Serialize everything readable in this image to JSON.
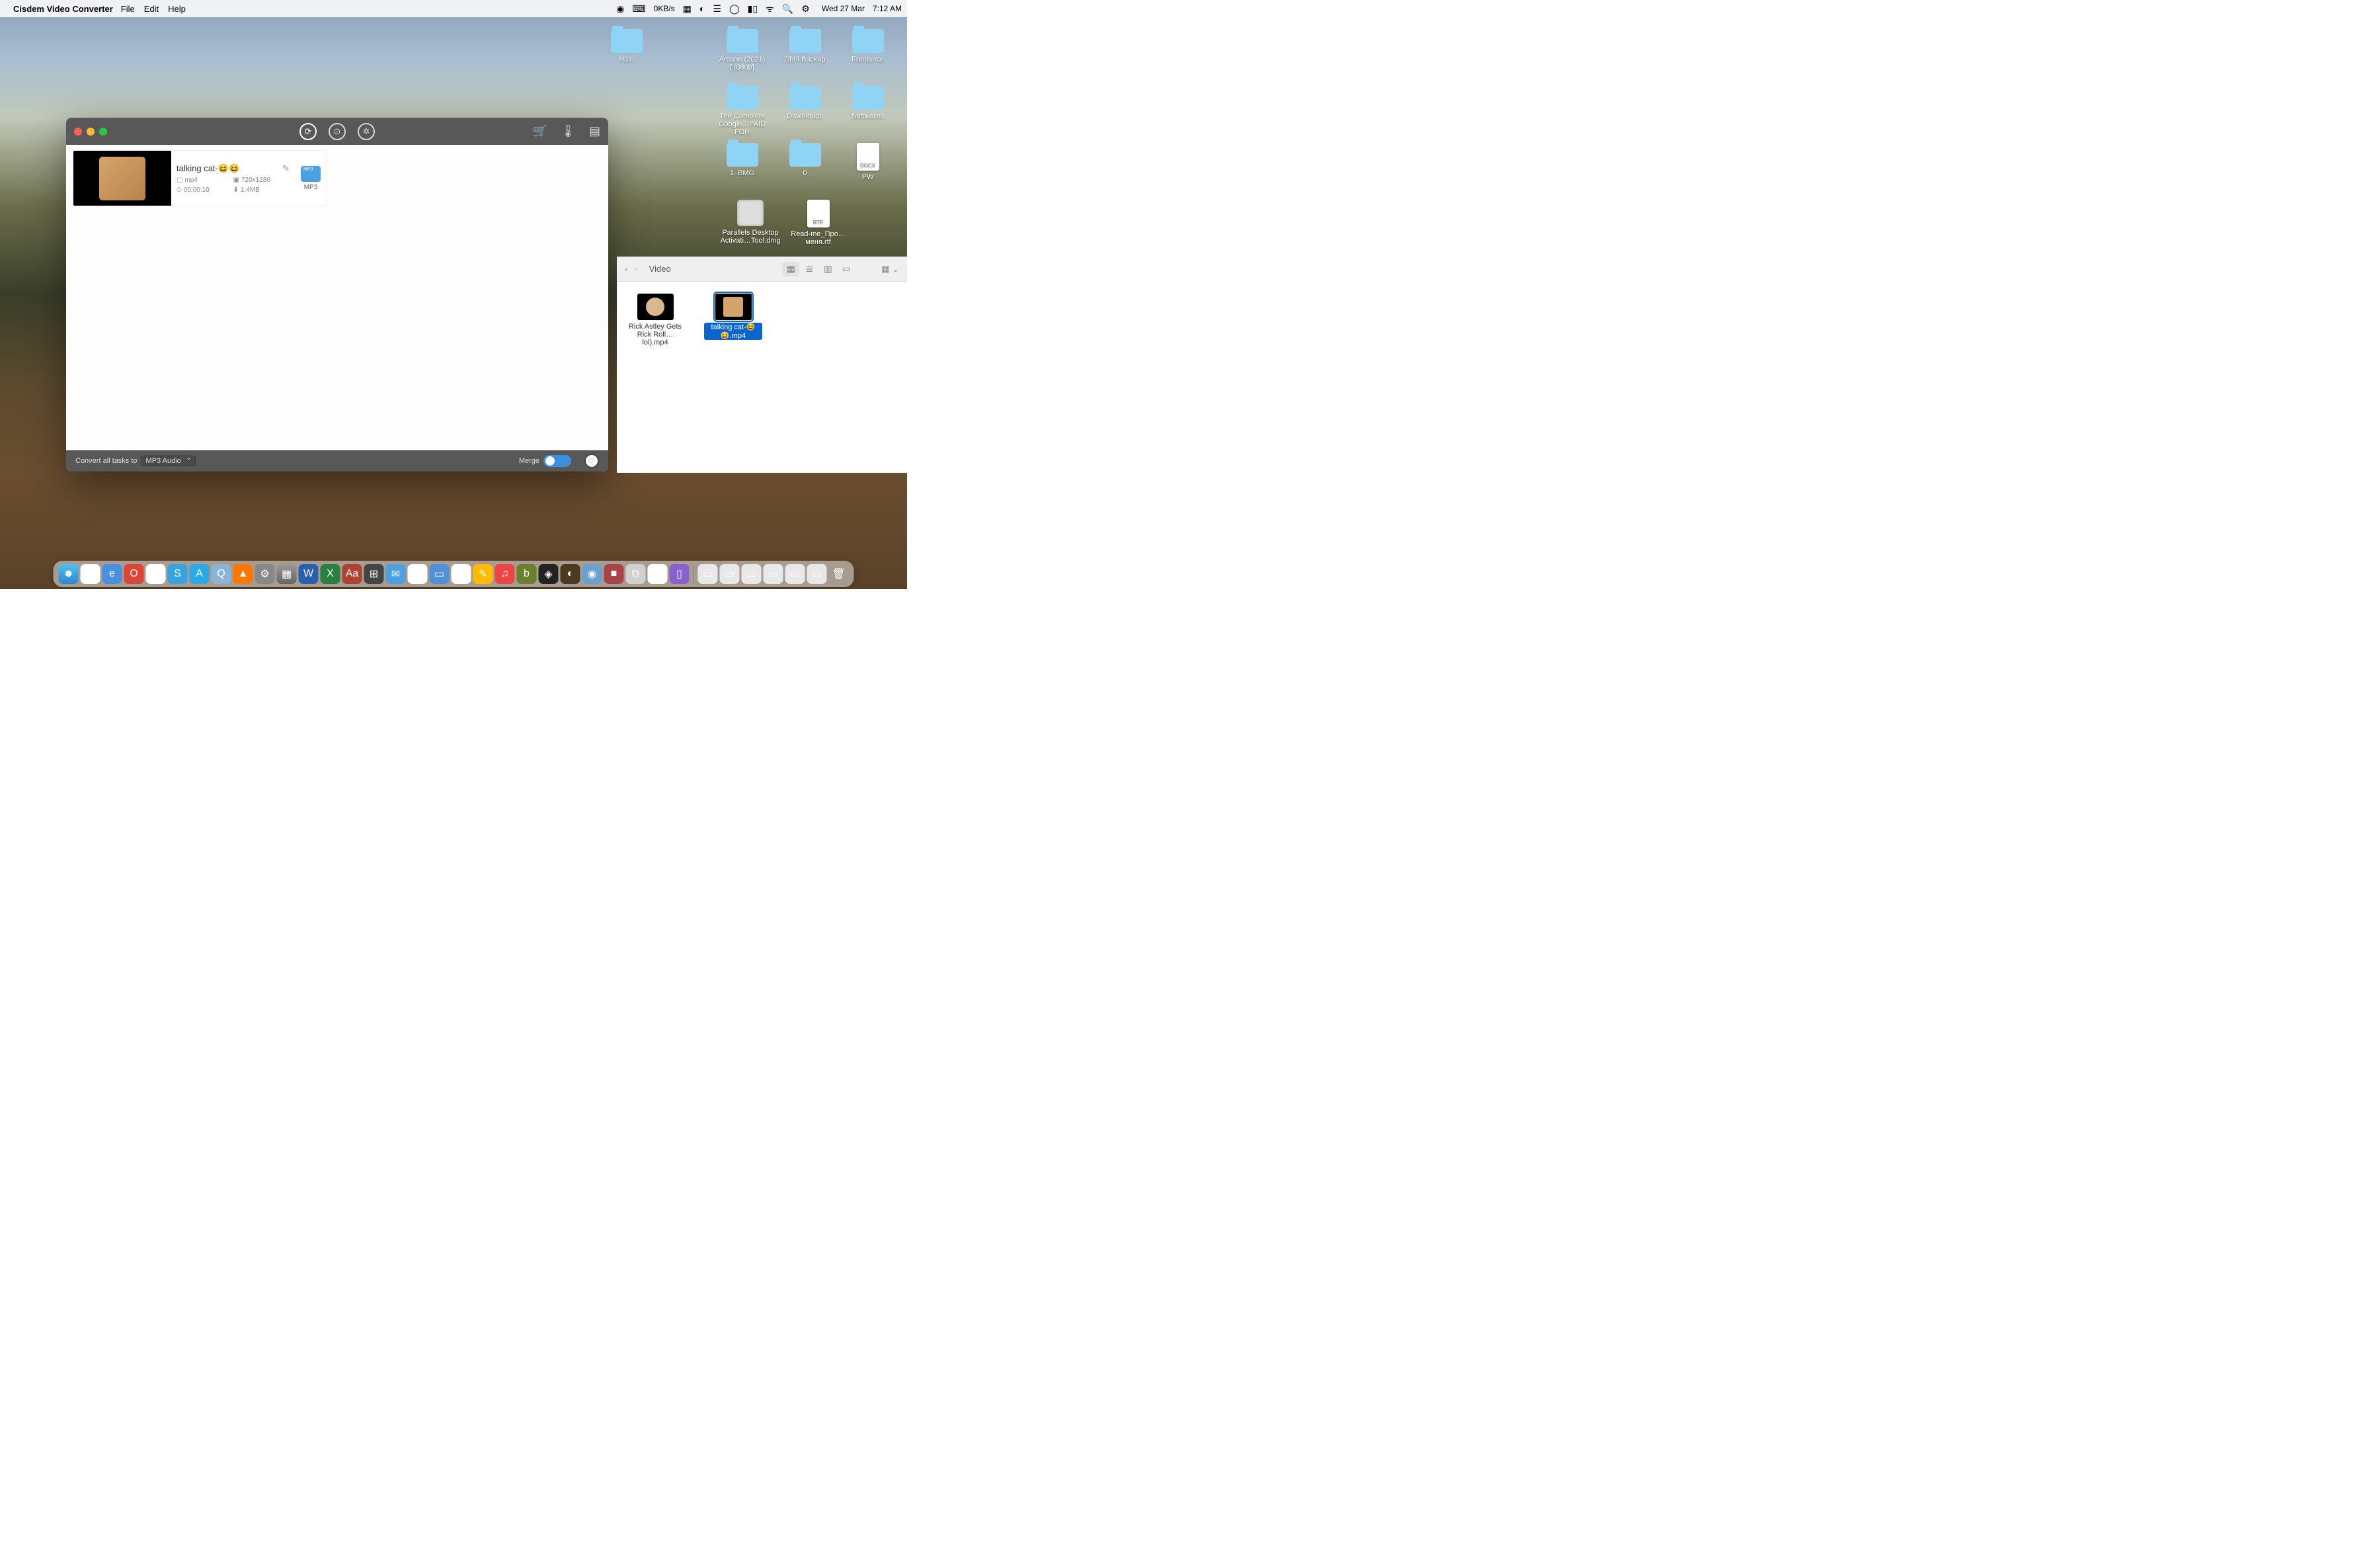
{
  "menubar": {
    "app": "Cisdem Video Converter",
    "items": [
      "File",
      "Edit",
      "Help"
    ],
    "net": "0KB/s",
    "date": "Wed 27 Mar",
    "time": "7:12 AM"
  },
  "desktop_icons": [
    {
      "type": "folder",
      "label": "Halo"
    },
    {
      "type": "folder",
      "label": "Arcane (2021) [1080p]"
    },
    {
      "type": "folder",
      "label": "Jibril Backup"
    },
    {
      "type": "folder",
      "label": "Freelance"
    },
    {
      "type": "folder",
      "label": "The Complete Google…PAID FOR"
    },
    {
      "type": "folder",
      "label": "Downloads"
    },
    {
      "type": "folder",
      "label": "Softwares"
    },
    {
      "type": "folder",
      "label": "1. BMG"
    },
    {
      "type": "folder",
      "label": "0"
    },
    {
      "type": "doc",
      "label": "PW",
      "badge": "DOCX"
    },
    {
      "type": "dmg",
      "label": "Parallels Desktop Activati…Tool.dmg"
    },
    {
      "type": "doc",
      "label": "Read-me_Про…меня.rtf",
      "badge": "RTF"
    }
  ],
  "converter": {
    "video": {
      "title": "talking cat-😆😆",
      "format": "mp4",
      "resolution": "720x1280",
      "duration": "00:00:10",
      "size": "1.4MB",
      "out_fmt": "MP3"
    },
    "footer": {
      "label": "Convert all tasks to",
      "select": "MP3 Audio",
      "merge": "Merge"
    }
  },
  "finder": {
    "title": "Video",
    "files": [
      {
        "label": "Rick Astley Gets Rick Roll…lol).mp4",
        "sel": false,
        "thumb": "face"
      },
      {
        "label": "talking cat-😆😆.mp4",
        "sel": true,
        "thumb": "cat"
      }
    ]
  },
  "dock": [
    "Finder",
    "Safari",
    "Edge",
    "Opera",
    "Chrome",
    "Skype",
    "App Store",
    "QuickTime",
    "VLC",
    "Settings",
    "Launchpad",
    "Word",
    "Excel",
    "Dictionary",
    "Calculator",
    "Mail",
    "Calendar",
    "Files",
    "Reminders",
    "Notes",
    "Music",
    "App",
    "App",
    "App",
    "App",
    "App",
    "App",
    "Photos",
    "App",
    "|",
    "Recent",
    "Recent",
    "Recent",
    "Recent",
    "Recent",
    "Recent",
    "Trash"
  ]
}
